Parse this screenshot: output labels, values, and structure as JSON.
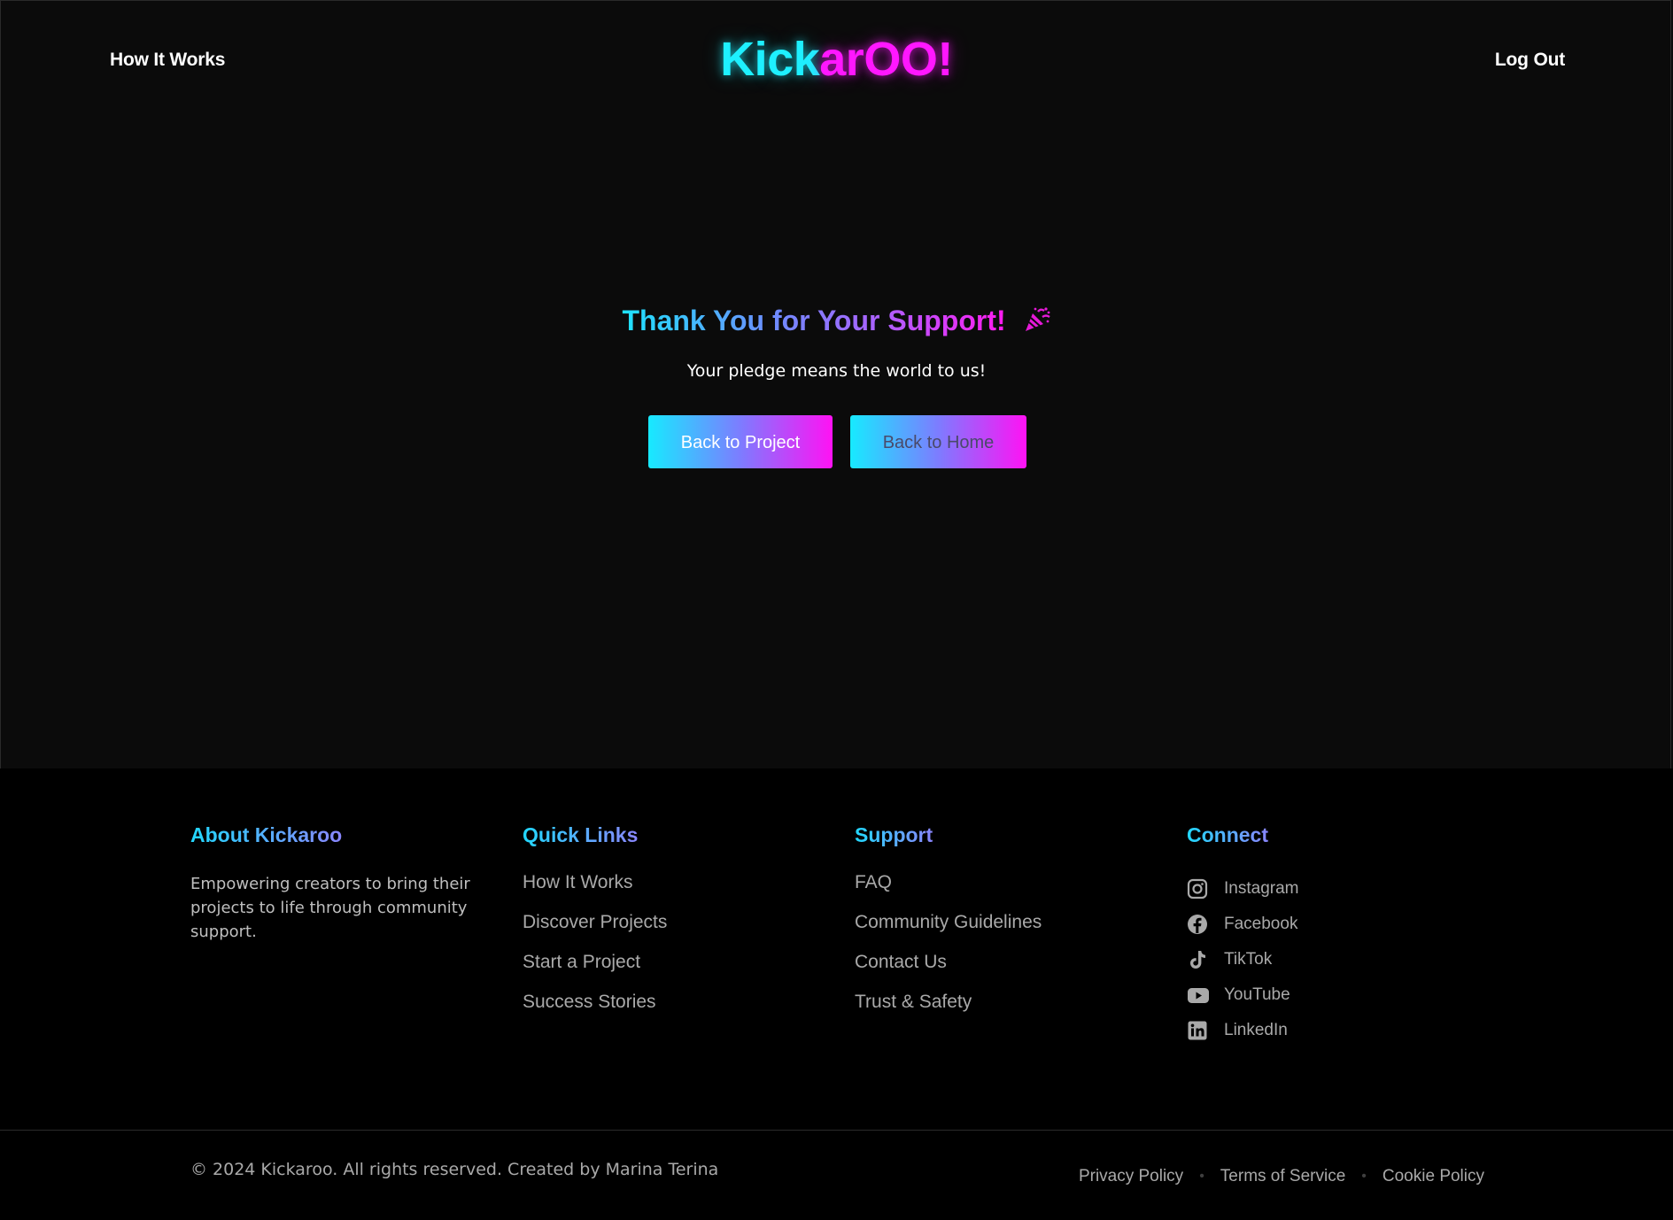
{
  "header": {
    "nav_left": "How It Works",
    "logo_part1": "Kick",
    "logo_part2": "arOO!",
    "nav_right": "Log Out"
  },
  "main": {
    "title": "Thank You for Your Support!",
    "title_icon": "party-popper-icon",
    "subtitle": "Your pledge means the world to us!",
    "back_project_label": "Back to Project",
    "back_home_label": "Back to Home"
  },
  "footer": {
    "about": {
      "heading": "About Kickaroo",
      "text": "Empowering creators to bring their projects to life through community support."
    },
    "quick_links": {
      "heading": "Quick Links",
      "items": [
        "How It Works",
        "Discover Projects",
        "Start a Project",
        "Success Stories"
      ]
    },
    "support": {
      "heading": "Support",
      "items": [
        "FAQ",
        "Community Guidelines",
        "Contact Us",
        "Trust & Safety"
      ]
    },
    "connect": {
      "heading": "Connect",
      "items": [
        {
          "label": "Instagram",
          "icon": "instagram-icon"
        },
        {
          "label": "Facebook",
          "icon": "facebook-icon"
        },
        {
          "label": "TikTok",
          "icon": "tiktok-icon"
        },
        {
          "label": "YouTube",
          "icon": "youtube-icon"
        },
        {
          "label": "LinkedIn",
          "icon": "linkedin-icon"
        }
      ]
    },
    "copyright": "© 2024 Kickaroo. All rights reserved. Created by Marina Terina",
    "legal": [
      "Privacy Policy",
      "Terms of Service",
      "Cookie Policy"
    ]
  },
  "colors": {
    "background": "#0b0b0b",
    "footer_background": "#000000",
    "cyan": "#1ef0ff",
    "magenta": "#ff17ff",
    "muted_text": "#a9a9a9"
  }
}
